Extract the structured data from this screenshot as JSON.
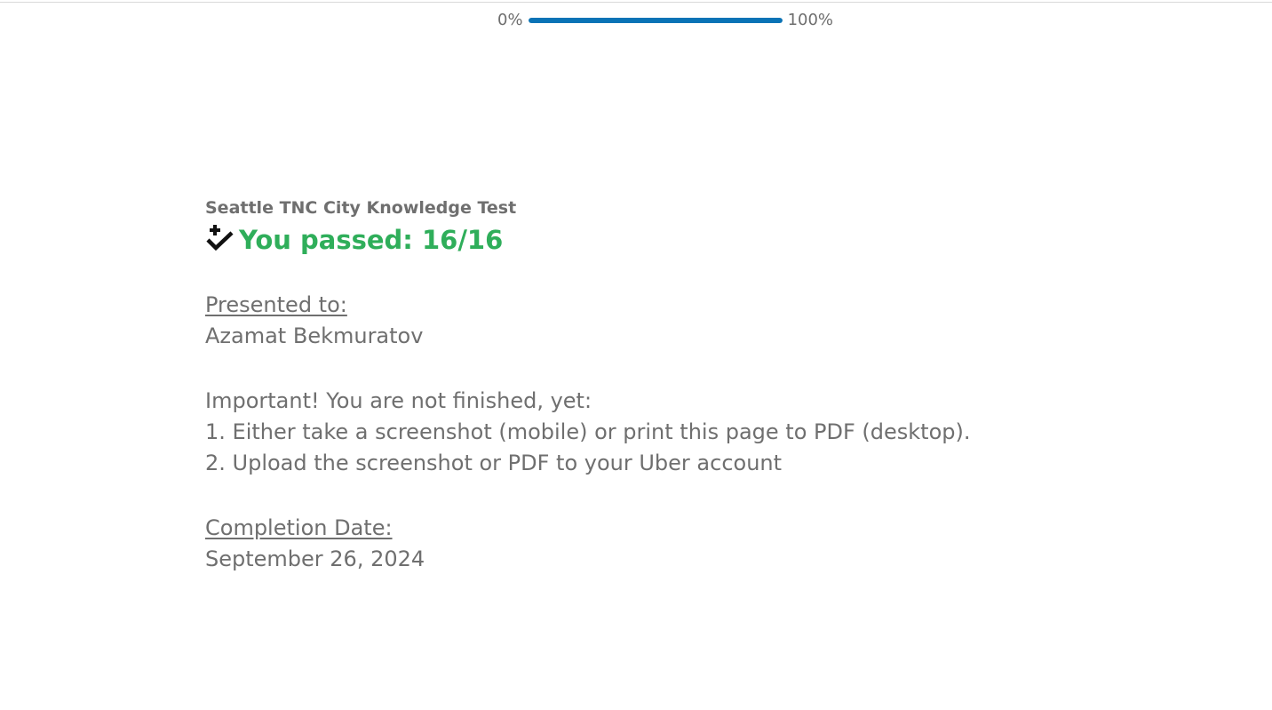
{
  "progress": {
    "start_label": "0%",
    "end_label": "100%",
    "fraction": 1.0,
    "fill_color": "#0a73b6"
  },
  "certificate": {
    "test_title": "Seattle TNC City Knowledge Test",
    "result_icon": "checkmark-plus-icon",
    "result_text": "You passed: 16/16",
    "result_color": "#2fae5a",
    "presented_label": "Presented to:",
    "recipient_name": "Azamat Bekmuratov",
    "important_heading": "Important! You are not finished, yet:",
    "instructions": [
      "1. Either take a screenshot (mobile) or print this page to PDF (desktop).",
      "2. Upload the screenshot or PDF to your Uber account"
    ],
    "completion_label": "Completion Date:",
    "completion_date": "September 26, 2024"
  }
}
